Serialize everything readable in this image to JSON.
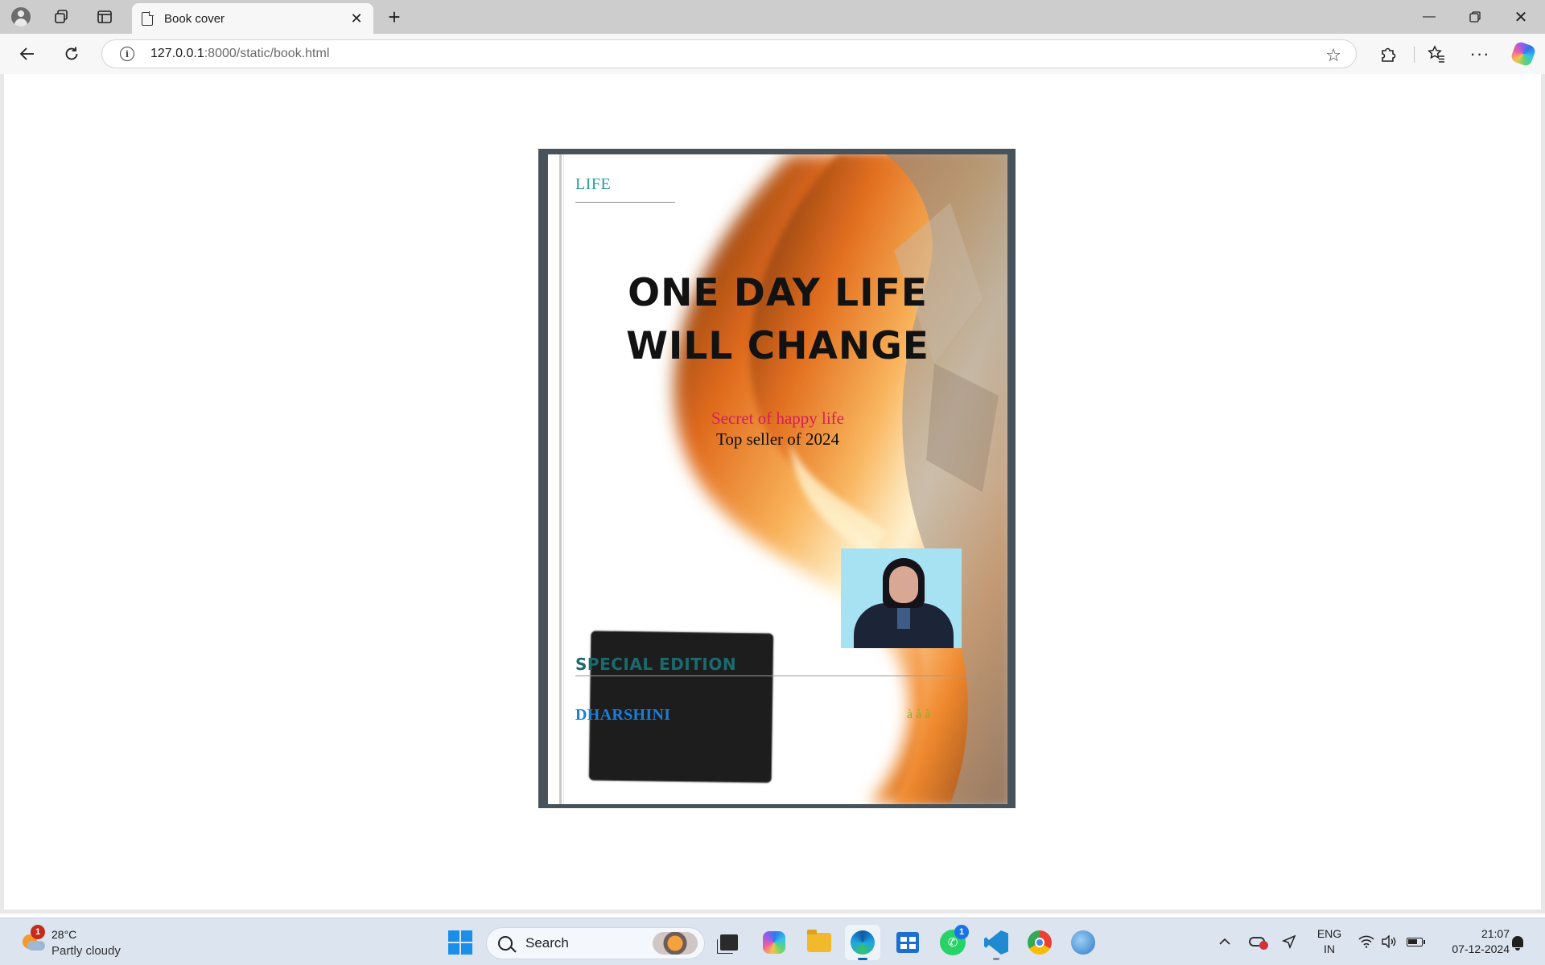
{
  "browser": {
    "tab_title": "Book cover",
    "url_host": "127.0.0.1",
    "url_rest": ":8000/static/book.html",
    "icons": {
      "profile": "profile-icon",
      "workspaces": "workspaces-icon",
      "vertical_tabs": "vertical-tabs-icon",
      "page": "page-icon",
      "close": "close-icon",
      "new_tab": "plus-icon",
      "back": "back-arrow-icon",
      "reload": "reload-icon",
      "site_info": "info-icon",
      "favorite": "star-icon",
      "extensions": "puzzle-icon",
      "favorites": "favorites-icon",
      "more": "more-icon",
      "copilot": "copilot-icon"
    }
  },
  "book": {
    "category": "LIFE",
    "title_line1": "ONE DAY LIFE",
    "title_line2": "WILL CHANGE",
    "subtitle": "Secret of happy life",
    "tagline": "Top seller of 2024",
    "edition": "SPECIAL EDITION",
    "author": "DHARSHINI",
    "garbled_text": "à à à ",
    "colors": {
      "category": "#2b9c9a",
      "subtitle": "#d4205a",
      "edition": "#1b6a6e",
      "author": "#1b7fd9",
      "garbled": "#8fb01e",
      "frame": "#47525a"
    }
  },
  "taskbar": {
    "weather_badge": "1",
    "temperature": "28°C",
    "condition": "Partly cloudy",
    "search_label": "Search",
    "whatsapp_badge": "1",
    "language": "ENG",
    "region": "IN",
    "time": "21:07",
    "date": "07-12-2024",
    "apps": [
      "start",
      "search",
      "task-view",
      "copilot",
      "file-explorer",
      "edge",
      "microsoft-store",
      "whatsapp",
      "vscode",
      "chrome",
      "globe"
    ]
  }
}
